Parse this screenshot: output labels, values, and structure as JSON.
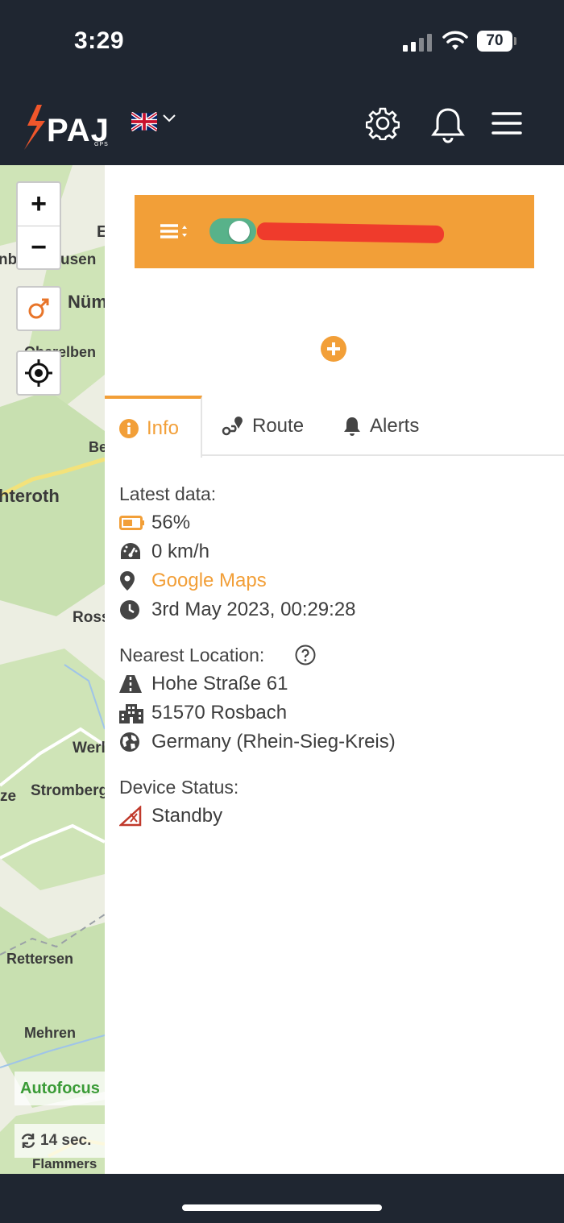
{
  "status_bar": {
    "time": "3:29",
    "battery_percent": "70",
    "signal_icon": "cellular-signal-icon",
    "wifi_icon": "wifi-icon"
  },
  "header": {
    "logo_text": "PAJ",
    "logo_sub": "GPS",
    "language_flag": "uk-flag-icon",
    "settings_icon": "gear-icon",
    "notifications_icon": "bell-icon",
    "menu_icon": "hamburger-menu-icon"
  },
  "map": {
    "zoom_in": "+",
    "zoom_out": "−",
    "labels": [
      "Nüm",
      "E",
      "nbe",
      "usen",
      "Oberelben",
      "Be",
      "hteroth",
      "Ross",
      "Werl",
      "ze",
      "Stromberg",
      "Rettersen",
      "Mehren",
      "Flammers"
    ],
    "autofocus_label": "Autofocus",
    "refresh_label": "14 sec."
  },
  "device": {
    "toggle_on": true,
    "name": ""
  },
  "tabs": [
    {
      "label": "Info",
      "icon": "info-circle-icon",
      "active": true
    },
    {
      "label": "Route",
      "icon": "route-icon",
      "active": false
    },
    {
      "label": "Alerts",
      "icon": "bell-icon",
      "active": false
    }
  ],
  "info": {
    "latest_data_title": "Latest data:",
    "battery": "56%",
    "speed": "0 km/h",
    "maps_link": "Google Maps",
    "timestamp": "3rd May 2023, 00:29:28",
    "nearest_location_title": "Nearest Location:",
    "street": "Hohe Straße 61",
    "city": "51570 Rosbach",
    "region": "Germany (Rhein-Sieg-Kreis)",
    "device_status_title": "Device Status:",
    "status": "Standby"
  },
  "colors": {
    "accent": "#f29f38",
    "header_bg": "#1f2631",
    "toggle_on": "#58b28a",
    "autofocus_text": "#3a9b36",
    "standby_icon": "#c0392b"
  }
}
